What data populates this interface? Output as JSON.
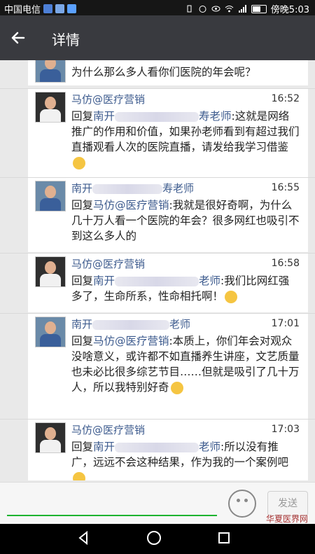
{
  "status_bar": {
    "carrier": "中国电信",
    "time": "傍晚5:03"
  },
  "header": {
    "title": "详情"
  },
  "messages": [
    {
      "name": "",
      "time": "",
      "text": "为什么那么多人看你们医院的年会呢？"
    },
    {
      "name": "马仿@医疗营销",
      "time": "16:52",
      "reply_to_prefix": "回复",
      "reply_to_name_left": "南开",
      "reply_to_name_right": "寿老师",
      "text": ":这就是网络推广的作用和价值，如果孙老师看到有超过我们直播观看人次的医院直播，请发给我学习借鉴"
    },
    {
      "name_left": "南开",
      "name_right": "寿老师",
      "time": "16:55",
      "reply_to_prefix": "回复",
      "reply_to_name": "马仿@医疗营销",
      "text": ":我就是很好奇啊，为什么几十万人看一个医院的年会？很多网红也吸引不到这么多人的"
    },
    {
      "name": "马仿@医疗营销",
      "time": "16:58",
      "reply_to_prefix": "回复",
      "reply_to_name_left": "南开",
      "reply_to_name_right": "老师",
      "text": ":我们比网红强多了，生命所系，性命相托啊！"
    },
    {
      "name_left": "南开",
      "name_right": "老师",
      "time": "17:01",
      "reply_to_prefix": "回复",
      "reply_to_name": "马仿@医疗营销",
      "text": ":本质上，你们年会对观众没啥意义，或许都不如直播养生讲座，文艺质量也未必比很多综艺节目……但就是吸引了几十万人，所以我特别好奇"
    },
    {
      "name": "马仿@医疗营销",
      "time": "17:03",
      "reply_to_prefix": "回复",
      "reply_to_name_left": "南开",
      "reply_to_name_right": "老师",
      "text": ":所以没有推广，远远不会这种结果，作为我的一个案例吧"
    }
  ],
  "input": {
    "send_label": "发送"
  },
  "watermark": "华夏医界网"
}
